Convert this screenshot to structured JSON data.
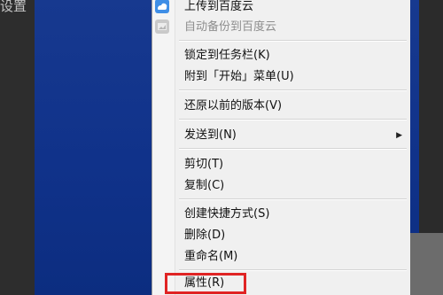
{
  "background_label": "设置",
  "menu": {
    "items": [
      {
        "label": "上传到百度云",
        "enabled": true,
        "icon": "baidu-cloud-icon"
      },
      {
        "label": "自动备份到百度云",
        "enabled": false,
        "icon": "baidu-cloud-backup-icon"
      },
      {
        "label": "锁定到任务栏(K)",
        "enabled": true
      },
      {
        "label": "附到「开始」菜单(U)",
        "enabled": true
      },
      {
        "label": "还原以前的版本(V)",
        "enabled": true
      },
      {
        "label": "发送到(N)",
        "enabled": true,
        "submenu": true
      },
      {
        "label": "剪切(T)",
        "enabled": true
      },
      {
        "label": "复制(C)",
        "enabled": true
      },
      {
        "label": "创建快捷方式(S)",
        "enabled": true
      },
      {
        "label": "删除(D)",
        "enabled": true
      },
      {
        "label": "重命名(M)",
        "enabled": true
      },
      {
        "label": "属性(R)",
        "enabled": true
      }
    ],
    "submenu_arrow": "▶"
  },
  "colors": {
    "desktop": "#12348a",
    "menu": "#f0f0f0",
    "highlight_border": "#e02424"
  }
}
